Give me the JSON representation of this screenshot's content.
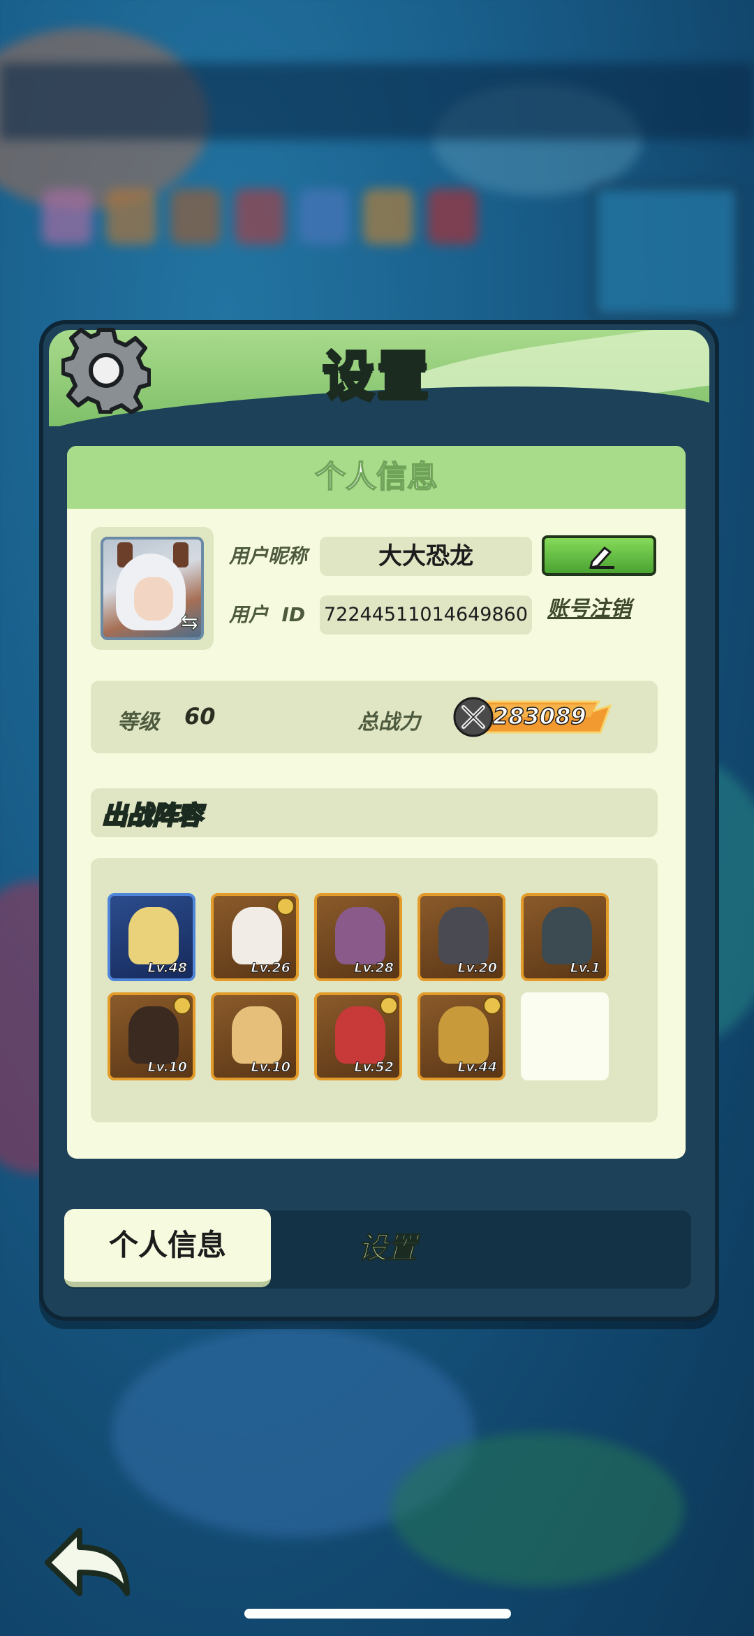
{
  "window": {
    "title": "设置"
  },
  "section": {
    "title": "个人信息"
  },
  "profile": {
    "nickname_label": "用户昵称",
    "nickname": "大大恐龙",
    "id_label": "用户  ID",
    "user_id": "72244511014649860",
    "delete_account_link": "账号注销",
    "edit_icon": "pencil-icon"
  },
  "stats": {
    "level_label": "等级",
    "level": "60",
    "power_label": "总战力",
    "power": "283089"
  },
  "lineup": {
    "title": "出战阵容",
    "heroes": [
      {
        "lv": "Lv.48",
        "frame": "blue"
      },
      {
        "lv": "Lv.26",
        "frame": "gold"
      },
      {
        "lv": "Lv.28",
        "frame": "gold"
      },
      {
        "lv": "Lv.20",
        "frame": "gold"
      },
      {
        "lv": "Lv.1",
        "frame": "gold"
      },
      {
        "lv": "Lv.10",
        "frame": "gold"
      },
      {
        "lv": "Lv.10",
        "frame": "gold"
      },
      {
        "lv": "Lv.52",
        "frame": "gold"
      },
      {
        "lv": "Lv.44",
        "frame": "gold"
      }
    ]
  },
  "tabs": [
    {
      "label": "个人信息",
      "active": true
    },
    {
      "label": "设置",
      "active": false
    }
  ],
  "colors": {
    "header_green": "#a9dc8a",
    "card_bg": "#f6fbdf",
    "panel_dark": "#1d4158",
    "power_orange": "#f29a30",
    "edit_green": "#4aa332"
  }
}
